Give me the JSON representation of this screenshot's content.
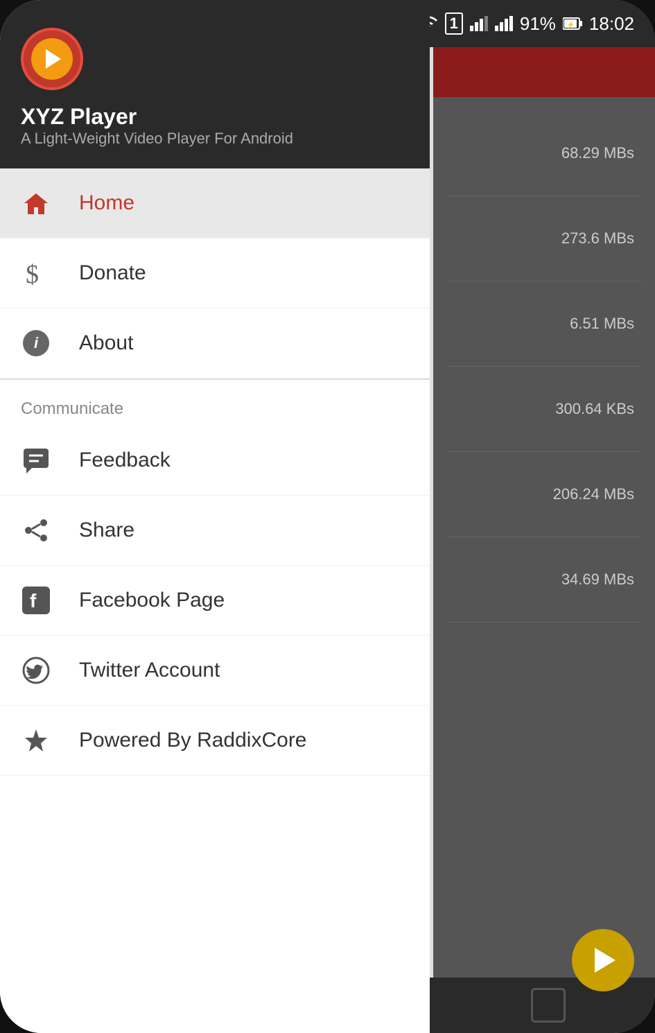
{
  "statusBar": {
    "battery": "91%",
    "time": "18:02",
    "icons": [
      "wifi",
      "sim1",
      "signal1",
      "signal2",
      "battery"
    ]
  },
  "app": {
    "name": "XYZ Player",
    "tagline": "A Light-Weight Video Player For Android"
  },
  "drawer": {
    "navItems": [
      {
        "id": "home",
        "label": "Home",
        "icon": "home",
        "active": true
      },
      {
        "id": "donate",
        "label": "Donate",
        "icon": "dollar",
        "active": false
      },
      {
        "id": "about",
        "label": "About",
        "icon": "info",
        "active": false
      }
    ],
    "sectionTitle": "Communicate",
    "communicateItems": [
      {
        "id": "feedback",
        "label": "Feedback",
        "icon": "feedback"
      },
      {
        "id": "share",
        "label": "Share",
        "icon": "share"
      },
      {
        "id": "facebook",
        "label": "Facebook Page",
        "icon": "facebook"
      },
      {
        "id": "twitter",
        "label": "Twitter Account",
        "icon": "twitter"
      },
      {
        "id": "raddix",
        "label": "Powered By RaddixCore",
        "icon": "star"
      }
    ]
  },
  "fileSizes": [
    "68.29 MBs",
    "273.6 MBs",
    "6.51 MBs",
    "300.64 KBs",
    "206.24 MBs",
    "34.69 MBs"
  ]
}
